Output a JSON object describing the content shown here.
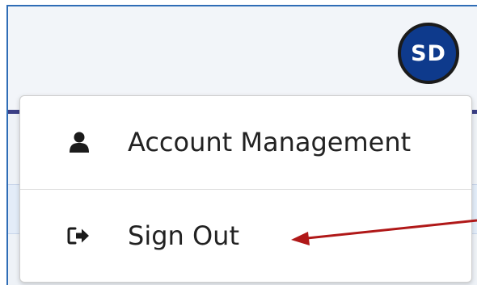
{
  "user": {
    "initials": "SD",
    "avatar_color": "#0e3a8c"
  },
  "menu": {
    "items": [
      {
        "label": "Account Management",
        "icon": "user-icon"
      },
      {
        "label": "Sign Out",
        "icon": "sign-out-icon"
      }
    ]
  },
  "annotation": {
    "arrow_color": "#b01818",
    "points_to": "Sign Out"
  },
  "colors": {
    "frame_border": "#2f6db6",
    "nav_stripe": "#3b3f86"
  }
}
